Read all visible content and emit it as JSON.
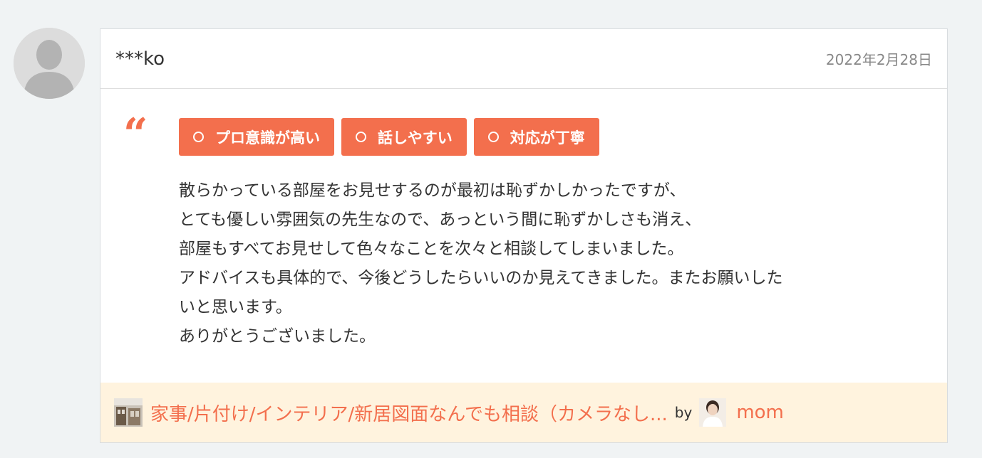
{
  "review": {
    "username": "***ko",
    "date": "2022年2月28日",
    "quote_mark": "“",
    "tags": [
      {
        "label": "プロ意識が高い"
      },
      {
        "label": "話しやすい"
      },
      {
        "label": "対応が丁寧"
      }
    ],
    "text_lines": [
      "散らかっている部屋をお見せするのが最初は恥ずかしかったですが、",
      "とても優しい雰囲気の先生なので、あっという間に恥ずかしさも消え、",
      "部屋もすべてお見せして色々なことを次々と相談してしまいました。",
      "アドバイスも具体的で、今後どうしたらいいのか見えてきました。またお願いした",
      "いと思います。",
      "ありがとうございました。"
    ]
  },
  "footer": {
    "service_title": "家事/片付け/インテリア/新居図面なんでも相談（カメラなし...",
    "by_label": "by",
    "provider_name": "mom"
  },
  "colors": {
    "accent": "#f36f4d",
    "footer_bg": "#fff3de",
    "page_bg": "#f0f3f4"
  }
}
